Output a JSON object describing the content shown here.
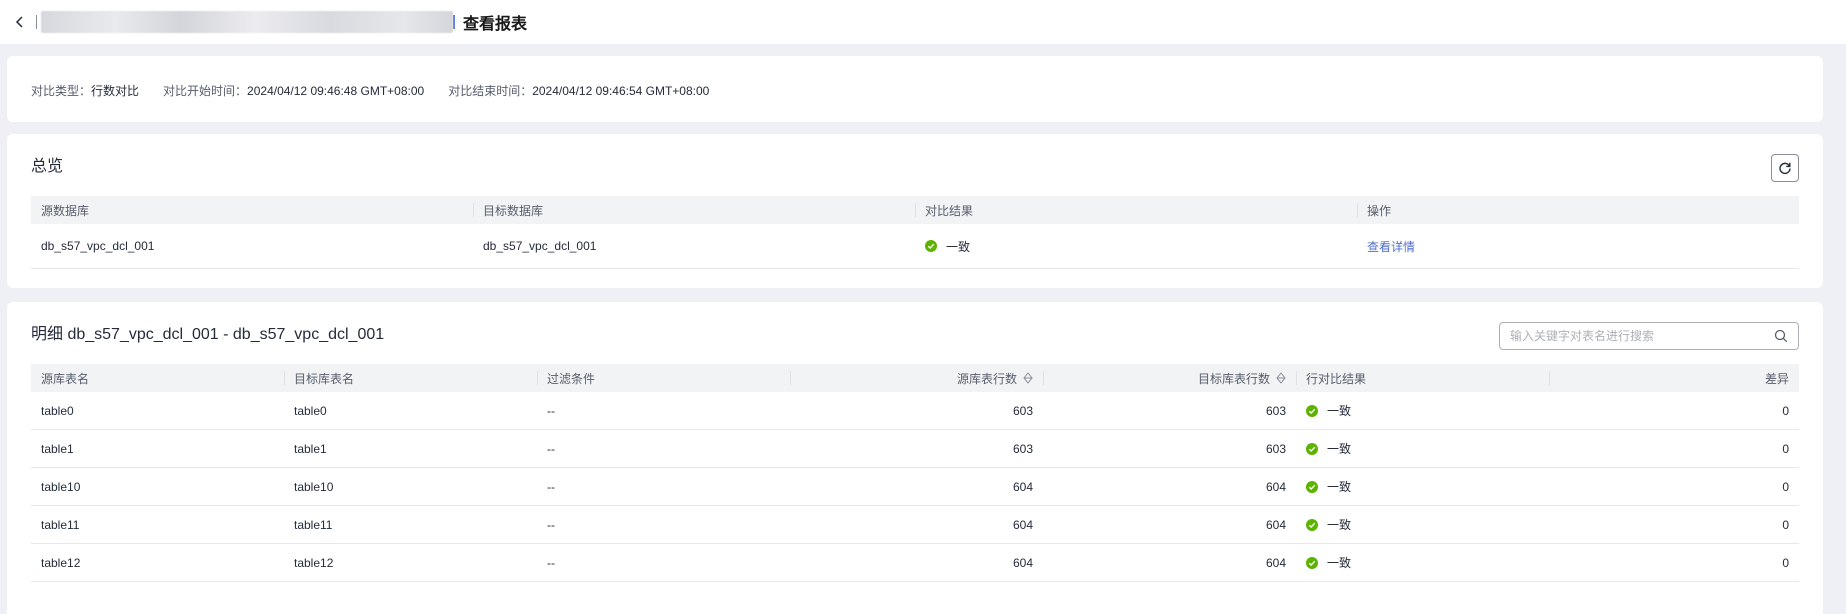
{
  "header": {
    "title": "查看报表"
  },
  "info": {
    "compare_type_label": "对比类型：",
    "compare_type_value": "行数对比",
    "start_label": "对比开始时间：",
    "start_value": "2024/04/12 09:46:48 GMT+08:00",
    "end_label": "对比结束时间：",
    "end_value": "2024/04/12 09:46:54 GMT+08:00"
  },
  "overview": {
    "title": "总览",
    "columns": [
      "源数据库",
      "目标数据库",
      "对比结果",
      "操作"
    ],
    "row": {
      "source_db": "db_s57_vpc_dcl_001",
      "target_db": "db_s57_vpc_dcl_001",
      "result": "一致",
      "action": "查看详情"
    }
  },
  "detail": {
    "title": "明细 db_s57_vpc_dcl_001 - db_s57_vpc_dcl_001",
    "search_placeholder": "输入关键字对表名进行搜索",
    "columns": [
      "源库表名",
      "目标库表名",
      "过滤条件",
      "源库表行数",
      "目标库表行数",
      "行对比结果",
      "差异"
    ],
    "rows": [
      {
        "src": "table0",
        "dst": "table0",
        "filter": "--",
        "src_rows": "603",
        "dst_rows": "603",
        "result": "一致",
        "diff": "0"
      },
      {
        "src": "table1",
        "dst": "table1",
        "filter": "--",
        "src_rows": "603",
        "dst_rows": "603",
        "result": "一致",
        "diff": "0"
      },
      {
        "src": "table10",
        "dst": "table10",
        "filter": "--",
        "src_rows": "604",
        "dst_rows": "604",
        "result": "一致",
        "diff": "0"
      },
      {
        "src": "table11",
        "dst": "table11",
        "filter": "--",
        "src_rows": "604",
        "dst_rows": "604",
        "result": "一致",
        "diff": "0"
      },
      {
        "src": "table12",
        "dst": "table12",
        "filter": "--",
        "src_rows": "604",
        "dst_rows": "604",
        "result": "一致",
        "diff": "0"
      }
    ]
  },
  "colors": {
    "accent": "#526ecc",
    "success": "#5cb300",
    "page_bg": "#eef0f5"
  }
}
